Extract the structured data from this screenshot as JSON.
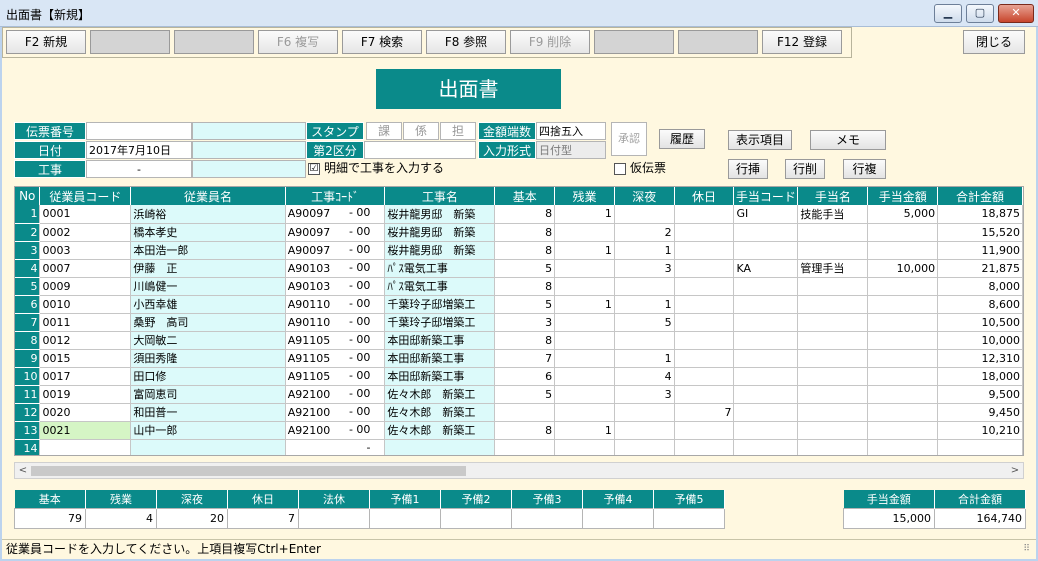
{
  "window": {
    "title": "出面書【新規】"
  },
  "toolbar": {
    "buttons": [
      {
        "label": "F2 新規",
        "state": "enabled"
      },
      {
        "label": "",
        "state": "blank"
      },
      {
        "label": "",
        "state": "blank"
      },
      {
        "label": "F6 複写",
        "state": "disabled"
      },
      {
        "label": "F7 検索",
        "state": "enabled"
      },
      {
        "label": "F8 参照",
        "state": "enabled"
      },
      {
        "label": "F9 削除",
        "state": "disabled"
      },
      {
        "label": "",
        "state": "blank"
      },
      {
        "label": "",
        "state": "blank"
      },
      {
        "label": "F12 登録",
        "state": "enabled"
      }
    ],
    "close_label": "閉じる"
  },
  "form_title": "出面書",
  "header": {
    "denpyo_label": "伝票番号",
    "denpyo_value": "",
    "date_label": "日付",
    "date_value": "2017年7月10日",
    "koji_label": "工事",
    "koji_value": "-",
    "stamp_label": "スタンプ",
    "stamps": [
      "課",
      "係",
      "担"
    ],
    "kubun_label": "第2区分",
    "kubun_value": "",
    "meisai_label": "明細で工事を入力する",
    "meisai_checked": "☑",
    "rounding_label": "金額端数",
    "rounding_value": "四捨五入",
    "input_label": "入力形式",
    "input_value": "日付型",
    "approve_label": "承認",
    "history_label": "履歴",
    "kari_label": "仮伝票",
    "display_label": "表示項目",
    "memo_label": "メモ",
    "row_insert": "行挿",
    "row_delete": "行削",
    "row_copy": "行複"
  },
  "grid": {
    "columns": [
      "No",
      "従業員コード",
      "従業員名",
      "工事ｺｰﾄﾞ",
      "工事名",
      "基本",
      "残業",
      "深夜",
      "休日",
      "手当コード",
      "手当名",
      "手当金額",
      "合計金額"
    ],
    "rows": [
      {
        "no": "1",
        "code": "0001",
        "name": "浜崎裕",
        "kcode": "A90097",
        "ksuf": "- 00",
        "kname": "桜井龍男邸　新築",
        "kihon": "8",
        "zangyo": "1",
        "shinya": "",
        "kyujitsu": "",
        "tcode": "GI",
        "tname": "技能手当",
        "tamount": "5,000",
        "total": "18,875"
      },
      {
        "no": "2",
        "code": "0002",
        "name": "橋本孝史",
        "kcode": "A90097",
        "ksuf": "- 00",
        "kname": "桜井龍男邸　新築",
        "kihon": "8",
        "zangyo": "",
        "shinya": "2",
        "kyujitsu": "",
        "tcode": "",
        "tname": "",
        "tamount": "",
        "total": "15,520"
      },
      {
        "no": "3",
        "code": "0003",
        "name": "本田浩一郎",
        "kcode": "A90097",
        "ksuf": "- 00",
        "kname": "桜井龍男邸　新築",
        "kihon": "8",
        "zangyo": "1",
        "shinya": "1",
        "kyujitsu": "",
        "tcode": "",
        "tname": "",
        "tamount": "",
        "total": "11,900"
      },
      {
        "no": "4",
        "code": "0007",
        "name": "伊藤　正",
        "kcode": "A90103",
        "ksuf": "- 00",
        "kname": "ﾊﾟｽ電気工事",
        "kihon": "5",
        "zangyo": "",
        "shinya": "3",
        "kyujitsu": "",
        "tcode": "KA",
        "tname": "管理手当",
        "tamount": "10,000",
        "total": "21,875"
      },
      {
        "no": "5",
        "code": "0009",
        "name": "川嶋健一",
        "kcode": "A90103",
        "ksuf": "- 00",
        "kname": "ﾊﾟｽ電気工事",
        "kihon": "8",
        "zangyo": "",
        "shinya": "",
        "kyujitsu": "",
        "tcode": "",
        "tname": "",
        "tamount": "",
        "total": "8,000"
      },
      {
        "no": "6",
        "code": "0010",
        "name": "小西幸雄",
        "kcode": "A90110",
        "ksuf": "- 00",
        "kname": "千葉玲子邸増築工",
        "kihon": "5",
        "zangyo": "1",
        "shinya": "1",
        "kyujitsu": "",
        "tcode": "",
        "tname": "",
        "tamount": "",
        "total": "8,600"
      },
      {
        "no": "7",
        "code": "0011",
        "name": "桑野　高司",
        "kcode": "A90110",
        "ksuf": "- 00",
        "kname": "千葉玲子邸増築工",
        "kihon": "3",
        "zangyo": "",
        "shinya": "5",
        "kyujitsu": "",
        "tcode": "",
        "tname": "",
        "tamount": "",
        "total": "10,500"
      },
      {
        "no": "8",
        "code": "0012",
        "name": "大岡敏二",
        "kcode": "A91105",
        "ksuf": "- 00",
        "kname": "本田邸新築工事",
        "kihon": "8",
        "zangyo": "",
        "shinya": "",
        "kyujitsu": "",
        "tcode": "",
        "tname": "",
        "tamount": "",
        "total": "10,000"
      },
      {
        "no": "9",
        "code": "0015",
        "name": "須田秀隆",
        "kcode": "A91105",
        "ksuf": "- 00",
        "kname": "本田邸新築工事",
        "kihon": "7",
        "zangyo": "",
        "shinya": "1",
        "kyujitsu": "",
        "tcode": "",
        "tname": "",
        "tamount": "",
        "total": "12,310"
      },
      {
        "no": "10",
        "code": "0017",
        "name": "田口修",
        "kcode": "A91105",
        "ksuf": "- 00",
        "kname": "本田邸新築工事",
        "kihon": "6",
        "zangyo": "",
        "shinya": "4",
        "kyujitsu": "",
        "tcode": "",
        "tname": "",
        "tamount": "",
        "total": "18,000"
      },
      {
        "no": "11",
        "code": "0019",
        "name": "富岡恵司",
        "kcode": "A92100",
        "ksuf": "- 00",
        "kname": "佐々木郎　新築工",
        "kihon": "5",
        "zangyo": "",
        "shinya": "3",
        "kyujitsu": "",
        "tcode": "",
        "tname": "",
        "tamount": "",
        "total": "9,500"
      },
      {
        "no": "12",
        "code": "0020",
        "name": "和田普一",
        "kcode": "A92100",
        "ksuf": "- 00",
        "kname": "佐々木郎　新築工",
        "kihon": "",
        "zangyo": "",
        "shinya": "",
        "kyujitsu": "7",
        "tcode": "",
        "tname": "",
        "tamount": "",
        "total": "9,450"
      },
      {
        "no": "13",
        "code": "0021",
        "name": "山中一郎",
        "kcode": "A92100",
        "ksuf": "- 00",
        "kname": "佐々木郎　新築工",
        "kihon": "8",
        "zangyo": "1",
        "shinya": "",
        "kyujitsu": "",
        "tcode": "",
        "tname": "",
        "tamount": "",
        "total": "10,210"
      },
      {
        "no": "14",
        "code": "",
        "name": "",
        "kcode": "",
        "ksuf": "-",
        "kname": "",
        "kihon": "",
        "zangyo": "",
        "shinya": "",
        "kyujitsu": "",
        "tcode": "",
        "tname": "",
        "tamount": "",
        "total": ""
      }
    ]
  },
  "totals": {
    "columns": [
      "基本",
      "残業",
      "深夜",
      "休日",
      "法休",
      "予備1",
      "予備2",
      "予備3",
      "予備4",
      "予備5"
    ],
    "values": [
      "79",
      "4",
      "20",
      "7",
      "",
      "",
      "",
      "",
      "",
      ""
    ]
  },
  "totals_right": {
    "columns": [
      "手当金額",
      "合計金額"
    ],
    "values": [
      "15,000",
      "164,740"
    ]
  },
  "status": "従業員コードを入力してください。上項目複写Ctrl+Enter"
}
